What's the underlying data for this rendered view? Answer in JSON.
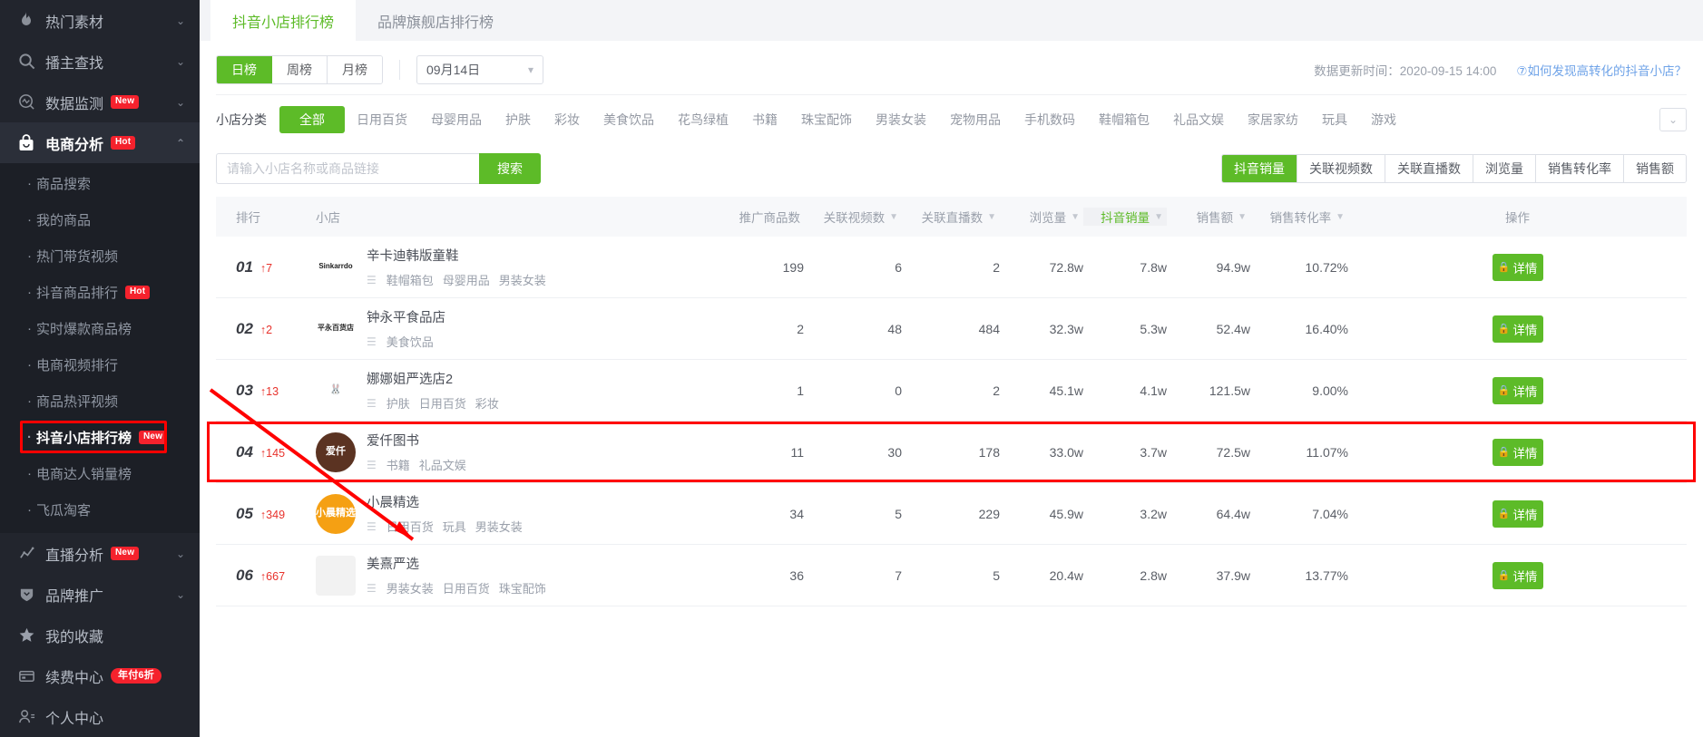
{
  "sidebar": {
    "groups": [
      {
        "label": "热门素材",
        "icon": "fire-icon",
        "badge": "",
        "chevron": "down",
        "active": false
      },
      {
        "label": "播主查找",
        "icon": "search-icon",
        "badge": "",
        "chevron": "down",
        "active": false
      },
      {
        "label": "数据监测",
        "icon": "monitor-icon",
        "badge": "New",
        "chevron": "down",
        "active": false
      },
      {
        "label": "电商分析",
        "icon": "bag-icon",
        "badge": "Hot",
        "chevron": "up",
        "active": true
      }
    ],
    "subitems": [
      {
        "label": "商品搜索",
        "badge": "",
        "current": false
      },
      {
        "label": "我的商品",
        "badge": "",
        "current": false
      },
      {
        "label": "热门带货视频",
        "badge": "",
        "current": false
      },
      {
        "label": "抖音商品排行",
        "badge": "Hot",
        "current": false
      },
      {
        "label": "实时爆款商品榜",
        "badge": "",
        "current": false
      },
      {
        "label": "电商视频排行",
        "badge": "",
        "current": false
      },
      {
        "label": "商品热评视频",
        "badge": "",
        "current": false
      },
      {
        "label": "抖音小店排行榜",
        "badge": "New",
        "current": true
      },
      {
        "label": "电商达人销量榜",
        "badge": "",
        "current": false
      },
      {
        "label": "飞瓜淘客",
        "badge": "",
        "current": false
      }
    ],
    "tail": [
      {
        "label": "直播分析",
        "icon": "chart-icon",
        "badge": "New",
        "chevron": "down",
        "active": false
      },
      {
        "label": "品牌推广",
        "icon": "shield-icon",
        "badge": "",
        "chevron": "down",
        "active": false
      },
      {
        "label": "我的收藏",
        "icon": "star-icon",
        "badge": "",
        "chevron": "",
        "active": false
      },
      {
        "label": "续费中心",
        "icon": "card-icon",
        "badge": "年付6折",
        "chevron": "",
        "active": false
      },
      {
        "label": "个人中心",
        "icon": "user-icon",
        "badge": "",
        "chevron": "",
        "active": false
      }
    ]
  },
  "tabs": [
    {
      "label": "抖音小店排行榜",
      "active": true
    },
    {
      "label": "品牌旗舰店排行榜",
      "active": false
    }
  ],
  "filters": {
    "period": [
      {
        "label": "日榜",
        "on": true
      },
      {
        "label": "周榜",
        "on": false
      },
      {
        "label": "月榜",
        "on": false
      }
    ],
    "date_value": "09月14日",
    "update_time": "数据更新时间：2020-09-15 14:00",
    "help_link": "⑦如何发现高转化的抖音小店？",
    "category_label": "小店分类",
    "categories": [
      {
        "label": "全部",
        "on": true
      },
      {
        "label": "日用百货",
        "on": false
      },
      {
        "label": "母婴用品",
        "on": false
      },
      {
        "label": "护肤",
        "on": false
      },
      {
        "label": "彩妆",
        "on": false
      },
      {
        "label": "美食饮品",
        "on": false
      },
      {
        "label": "花鸟绿植",
        "on": false
      },
      {
        "label": "书籍",
        "on": false
      },
      {
        "label": "珠宝配饰",
        "on": false
      },
      {
        "label": "男装女装",
        "on": false
      },
      {
        "label": "宠物用品",
        "on": false
      },
      {
        "label": "手机数码",
        "on": false
      },
      {
        "label": "鞋帽箱包",
        "on": false
      },
      {
        "label": "礼品文娱",
        "on": false
      },
      {
        "label": "家居家纺",
        "on": false
      },
      {
        "label": "玩具",
        "on": false
      },
      {
        "label": "游戏",
        "on": false
      }
    ]
  },
  "search": {
    "placeholder": "请输入小店名称或商品链接",
    "value": "",
    "button": "搜索"
  },
  "sort_buttons": [
    {
      "label": "抖音销量",
      "on": true
    },
    {
      "label": "关联视频数",
      "on": false
    },
    {
      "label": "关联直播数",
      "on": false
    },
    {
      "label": "浏览量",
      "on": false
    },
    {
      "label": "销售转化率",
      "on": false
    },
    {
      "label": "销售额",
      "on": false
    }
  ],
  "table": {
    "headers": {
      "rank": "排行",
      "shop": "小店",
      "promo_count": "推广商品数",
      "video_count": "关联视频数",
      "live_count": "关联直播数",
      "views": "浏览量",
      "sales_volume": "抖音销量",
      "sales_amount": "销售额",
      "conversion": "销售转化率",
      "action": "操作"
    },
    "action_label": "详情",
    "rows": [
      {
        "rank": "01",
        "change": "↑7",
        "name": "辛卡迪韩版童鞋",
        "logo_text": "Sinkarrdo",
        "logo_bg": "#ffffff",
        "logo_color": "#1a1a1a",
        "logo_shape": "square",
        "tags": [
          "鞋帽箱包",
          "母婴用品",
          "男装女装"
        ],
        "promo_count": "199",
        "video_count": "6",
        "live_count": "2",
        "views": "72.8w",
        "sales_volume": "7.8w",
        "sales_amount": "94.9w",
        "conversion": "10.72%",
        "highlight": false
      },
      {
        "rank": "02",
        "change": "↑2",
        "name": "钟永平食品店",
        "logo_text": "平永百货店",
        "logo_bg": "#ffffff",
        "logo_color": "#2a2a2a",
        "logo_shape": "square",
        "tags": [
          "美食饮品"
        ],
        "promo_count": "2",
        "video_count": "48",
        "live_count": "484",
        "views": "32.3w",
        "sales_volume": "5.3w",
        "sales_amount": "52.4w",
        "conversion": "16.40%",
        "highlight": false
      },
      {
        "rank": "03",
        "change": "↑13",
        "name": "娜娜姐严选店2",
        "logo_text": "🐰",
        "logo_bg": "#ffffff",
        "logo_color": "#d8a0a0",
        "logo_shape": "circle",
        "tags": [
          "护肤",
          "日用百货",
          "彩妆"
        ],
        "promo_count": "1",
        "video_count": "0",
        "live_count": "2",
        "views": "45.1w",
        "sales_volume": "4.1w",
        "sales_amount": "121.5w",
        "conversion": "9.00%",
        "highlight": false
      },
      {
        "rank": "04",
        "change": "↑145",
        "name": "爱仟图书",
        "logo_text": "爱仟",
        "logo_bg": "#5b3322",
        "logo_color": "#ffffff",
        "logo_shape": "circle",
        "tags": [
          "书籍",
          "礼品文娱"
        ],
        "promo_count": "11",
        "video_count": "30",
        "live_count": "178",
        "views": "33.0w",
        "sales_volume": "3.7w",
        "sales_amount": "72.5w",
        "conversion": "11.07%",
        "highlight": true
      },
      {
        "rank": "05",
        "change": "↑349",
        "name": "小晨精选",
        "logo_text": "小晨精选",
        "logo_bg": "#f5a013",
        "logo_color": "#ffffff",
        "logo_shape": "circle",
        "tags": [
          "日用百货",
          "玩具",
          "男装女装"
        ],
        "promo_count": "34",
        "video_count": "5",
        "live_count": "229",
        "views": "45.9w",
        "sales_volume": "3.2w",
        "sales_amount": "64.4w",
        "conversion": "7.04%",
        "highlight": false
      },
      {
        "rank": "06",
        "change": "↑667",
        "name": "美熹严选",
        "logo_text": "",
        "logo_bg": "#f2f2f2",
        "logo_color": "#888888",
        "logo_shape": "square",
        "tags": [
          "男装女装",
          "日用百货",
          "珠宝配饰"
        ],
        "promo_count": "36",
        "video_count": "7",
        "live_count": "5",
        "views": "20.4w",
        "sales_volume": "2.8w",
        "sales_amount": "37.9w",
        "conversion": "13.77%",
        "highlight": false
      }
    ]
  },
  "colors": {
    "accent_green": "#5dbb28",
    "highlight_red": "#ff0000",
    "rank_up_red": "#e8322c",
    "badge_red": "#f5222d",
    "link_blue": "#6fa3e8"
  }
}
